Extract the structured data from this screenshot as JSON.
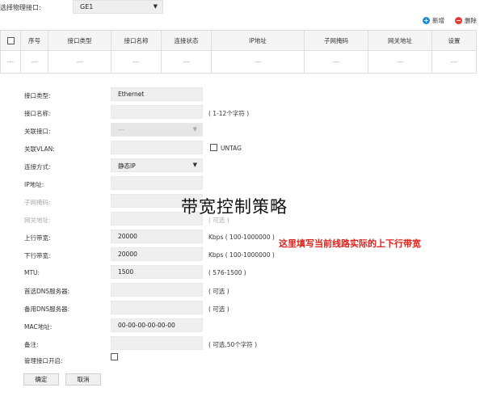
{
  "topbar": {
    "label": "选择物理接口:",
    "select_value": "GE1"
  },
  "actions": {
    "add_label": "新增",
    "delete_label": "删除"
  },
  "table": {
    "headers": [
      "序号",
      "接口类型",
      "接口名称",
      "连接状态",
      "IP地址",
      "子网掩码",
      "网关地址",
      "设置"
    ],
    "placeholder_cell": "---"
  },
  "form": {
    "interface_type": {
      "label": "接口类型:",
      "value": "Ethernet"
    },
    "interface_name": {
      "label": "接口名称:",
      "value": "",
      "hint": "( 1-12个字符 )"
    },
    "linked_interface": {
      "label": "关联接口:",
      "value": "---"
    },
    "linked_vlan": {
      "label": "关联VLAN:",
      "value": "",
      "untag_label": "UNTAG"
    },
    "connection_mode": {
      "label": "连接方式:",
      "value": "静态IP"
    },
    "ip_address": {
      "label": "IP地址:",
      "value": ""
    },
    "subnet_mask": {
      "label": "子网掩码:",
      "value": ""
    },
    "gateway": {
      "label": "网关地址:",
      "value": "",
      "hint": "( 可选 )"
    },
    "upstream_bandwidth": {
      "label": "上行带宽:",
      "value": "20000",
      "hint": "Kbps ( 100-1000000 )"
    },
    "downstream_bandwidth": {
      "label": "下行带宽:",
      "value": "20000",
      "hint": "Kbps ( 100-1000000 )"
    },
    "mtu": {
      "label": "MTU:",
      "value": "1500",
      "hint": "( 576-1500 )"
    },
    "primary_dns": {
      "label": "首选DNS服务器:",
      "value": "",
      "hint": "( 可选 )"
    },
    "secondary_dns": {
      "label": "备用DNS服务器:",
      "value": "",
      "hint": "( 可选 )"
    },
    "mac_address": {
      "label": "MAC地址:",
      "value": "00-00-00-00-00-00"
    },
    "remark": {
      "label": "备注:",
      "value": "",
      "hint": "( 可选,50个字符 )"
    },
    "mgmt_enable": {
      "label": "管理接口开启:"
    },
    "ok_label": "确定",
    "cancel_label": "取消"
  },
  "overlay": {
    "watermark_text": "带宽控制策略",
    "annotation_text": "这里填写当前线路实际的上下行带宽"
  },
  "colors": {
    "add_icon": "#1e88d6",
    "delete_icon": "#e53935",
    "annotation": "#e0201a"
  }
}
